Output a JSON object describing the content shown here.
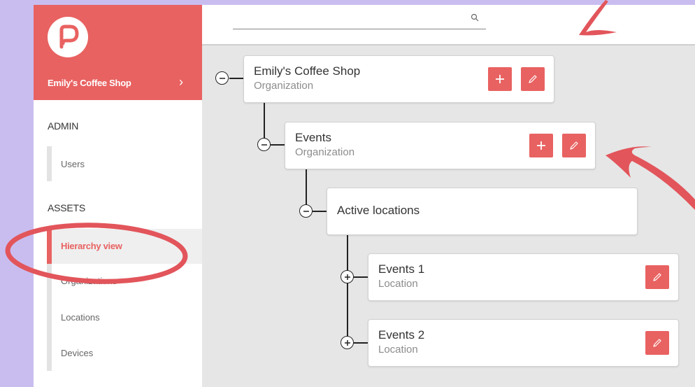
{
  "sidebar": {
    "brand_name": "Emily's Coffee Shop",
    "brand_arrow": "›",
    "sections": [
      {
        "title": "ADMIN",
        "items": [
          {
            "label": "Users"
          }
        ]
      },
      {
        "title": "ASSETS",
        "items": [
          {
            "label": "Hierarchy view",
            "active": true
          },
          {
            "label": "Organizations"
          },
          {
            "label": "Locations"
          },
          {
            "label": "Devices"
          }
        ]
      }
    ]
  },
  "search": {
    "placeholder": ""
  },
  "tree": [
    {
      "title": "Emily's Coffee Shop",
      "subtitle": "Organization",
      "toggle": "collapse"
    },
    {
      "title": "Events",
      "subtitle": "Organization",
      "toggle": "collapse"
    },
    {
      "title": "Active locations",
      "subtitle": "",
      "toggle": "collapse"
    },
    {
      "title": "Events 1",
      "subtitle": "Location",
      "toggle": "expand"
    },
    {
      "title": "Events 2",
      "subtitle": "Location",
      "toggle": "expand"
    }
  ],
  "icons": {
    "logo": "p-logo-icon",
    "search": "search-icon",
    "add": "plus-icon",
    "edit": "pencil-icon",
    "collapse": "minus-circle-icon",
    "expand": "plus-circle-icon"
  },
  "colors": {
    "accent": "#e86261",
    "background": "#c9bdf0",
    "panel": "#e6e6e6",
    "annotation": "#e2555b"
  }
}
